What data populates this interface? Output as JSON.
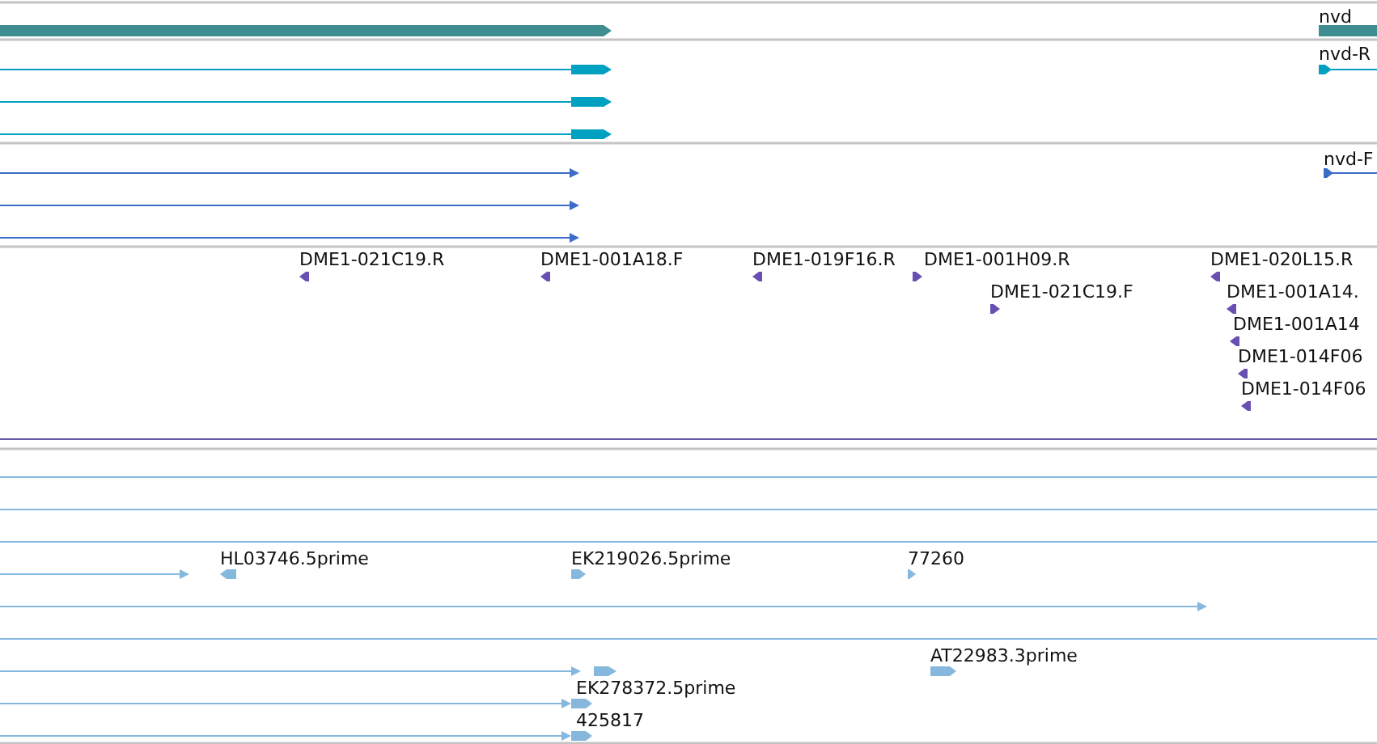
{
  "tracks": [
    {
      "kind": "gene",
      "features": [
        {
          "label": "nvd",
          "reverse": false
        }
      ]
    },
    {
      "kind": "mrna",
      "features": [
        {
          "label": "nvd-R",
          "reverse": false
        }
      ]
    },
    {
      "kind": "primer",
      "features": [
        {
          "label": "nvd-F",
          "reverse": false
        }
      ]
    },
    {
      "kind": "clone",
      "features": [
        {
          "label": "DME1-021C19.R",
          "reverse": true
        },
        {
          "label": "DME1-001A18.F",
          "reverse": true
        },
        {
          "label": "DME1-019F16.R",
          "reverse": true
        },
        {
          "label": "DME1-001H09.R",
          "reverse": false
        },
        {
          "label": "DME1-021C19.F",
          "reverse": false
        },
        {
          "label": "DME1-020L15.R",
          "reverse": true
        },
        {
          "label": "DME1-001A14.",
          "reverse": true
        },
        {
          "label": "DME1-001A14",
          "reverse": true
        },
        {
          "label": "DME1-014F06",
          "reverse": true
        },
        {
          "label": "DME1-014F06",
          "reverse": true
        }
      ]
    },
    {
      "kind": "est",
      "features": [
        {
          "label": "HL03746.5prime",
          "reverse": true
        },
        {
          "label": "EK219026.5prime",
          "reverse": false
        },
        {
          "label": "77260",
          "reverse": false
        },
        {
          "label": "AT22983.3prime",
          "reverse": false
        },
        {
          "label": "EK278372.5prime",
          "reverse": false
        },
        {
          "label": "425817",
          "reverse": false
        }
      ]
    }
  ]
}
